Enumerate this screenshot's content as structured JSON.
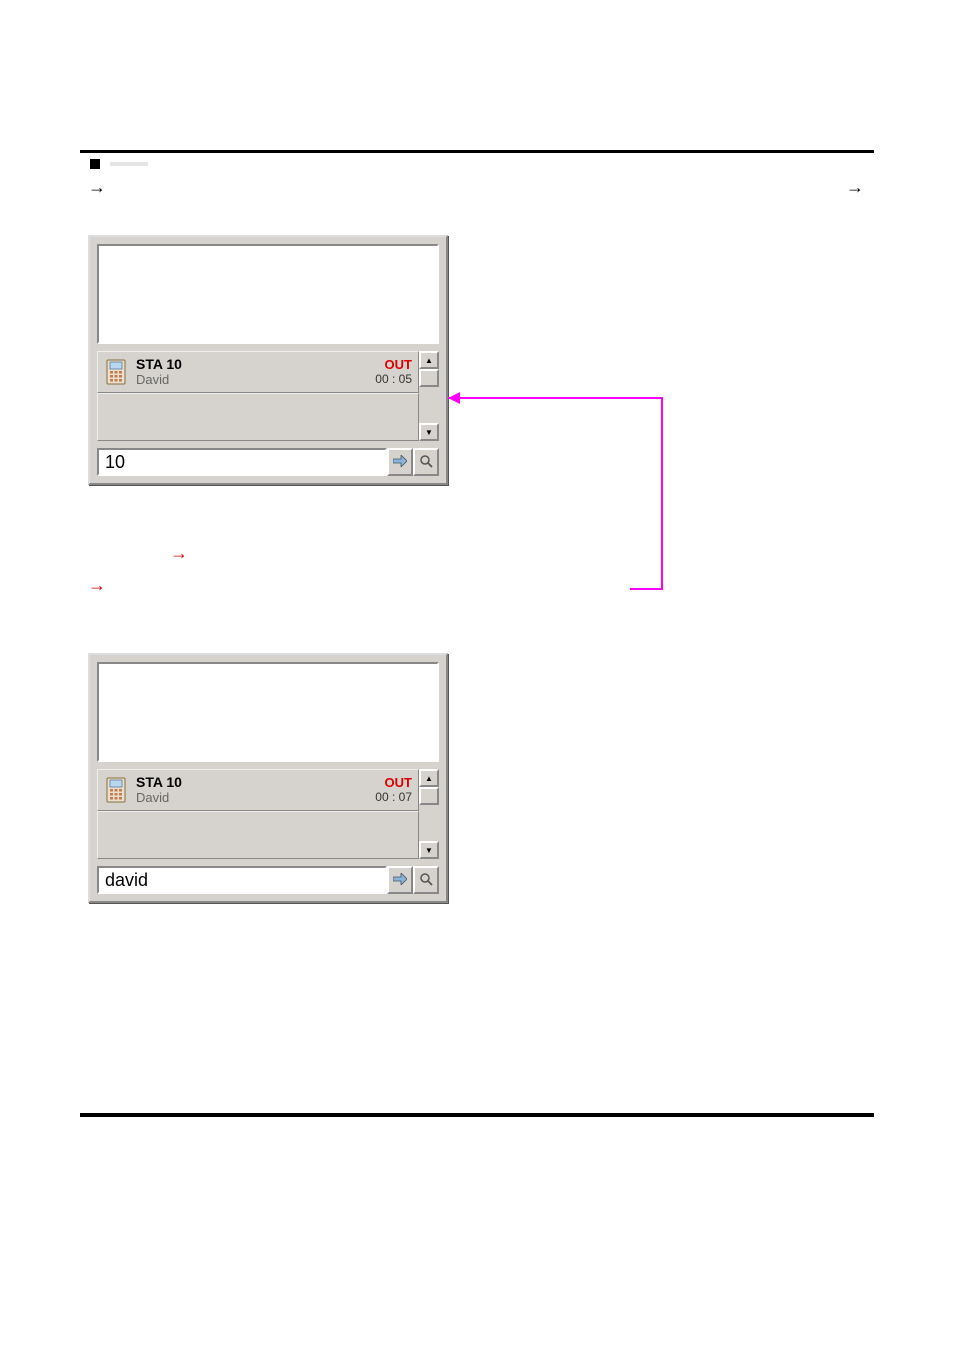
{
  "section": {
    "label_placeholder": " "
  },
  "panel1": {
    "list_item": {
      "title": "STA 10",
      "name": "David",
      "status": "OUT",
      "time": "00 : 05"
    },
    "input_value": "10"
  },
  "panel2": {
    "list_item": {
      "title": "STA 10",
      "name": "David",
      "status": "OUT",
      "time": "00 : 07"
    },
    "input_value": "david"
  },
  "arrows": {
    "right": "→"
  }
}
